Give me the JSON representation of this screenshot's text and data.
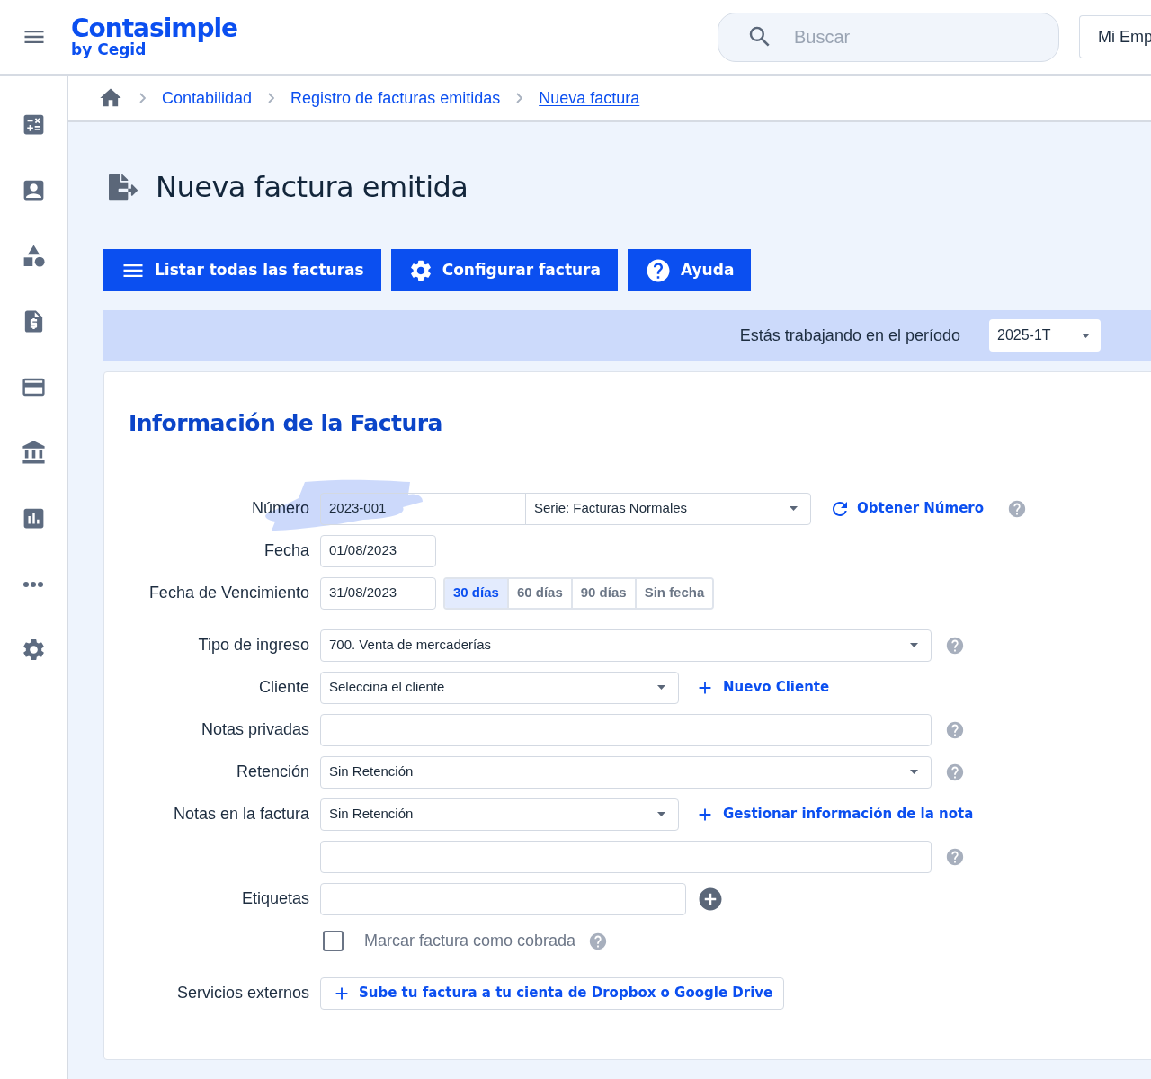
{
  "header": {
    "logo": {
      "name": "Contasimple",
      "sub": "by Cegid"
    },
    "search": {
      "placeholder": "Buscar"
    },
    "account": "Mi Emp"
  },
  "breadcrumb": [
    {
      "label": "Contabilidad",
      "current": false
    },
    {
      "label": "Registro de facturas emitidas",
      "current": false
    },
    {
      "label": "Nueva factura",
      "current": true
    }
  ],
  "title": "Nueva factura emitida",
  "toolbar": [
    {
      "kind": "list",
      "label": "Listar todas las facturas"
    },
    {
      "kind": "settings",
      "label": "Configurar factura"
    },
    {
      "kind": "help",
      "label": "Ayuda"
    }
  ],
  "period": {
    "label": "Estás trabajando en el período",
    "value": "2025-1T"
  },
  "card": {
    "title": "Información de la Factura",
    "fields": [
      {
        "kind": "number",
        "label": "Número",
        "value": "2023-001",
        "series": "Serie: Facturas Normales",
        "action": "Obtener Número",
        "help": true
      },
      {
        "kind": "date",
        "label": "Fecha",
        "value": "01/08/2023"
      },
      {
        "kind": "due_date",
        "label": "Fecha de Vencimiento",
        "value": "31/08/2023",
        "options": [
          {
            "label": "30 días",
            "selected": true
          },
          {
            "label": "60 días",
            "selected": false
          },
          {
            "label": "90 días",
            "selected": false
          },
          {
            "label": "Sin fecha",
            "selected": false
          }
        ]
      },
      {
        "kind": "wide_select",
        "label": "Tipo de ingreso",
        "value": "700. Venta de mercaderías",
        "help": true
      },
      {
        "kind": "select",
        "label": "Cliente",
        "value": "Seleccina el cliente",
        "action": "Nuevo Cliente"
      },
      {
        "kind": "text",
        "label": "Notas privadas",
        "help": true
      },
      {
        "kind": "wide_select",
        "label": "Retención",
        "value": "Sin Retención",
        "help": true
      },
      {
        "kind": "select",
        "label": "Notas en la factura",
        "value": "Sin Retención",
        "action": "Gestionar información de la nota"
      },
      {
        "kind": "text",
        "help": true
      },
      {
        "kind": "tags",
        "label": "Etiquetas"
      },
      {
        "kind": "checkbox",
        "label": "Marcar factura como cobrada",
        "checked": false,
        "help": true
      },
      {
        "kind": "external",
        "label": "Servicios externos",
        "action": "Sube tu factura a tu cienta de Dropbox o Google Drive"
      }
    ]
  }
}
